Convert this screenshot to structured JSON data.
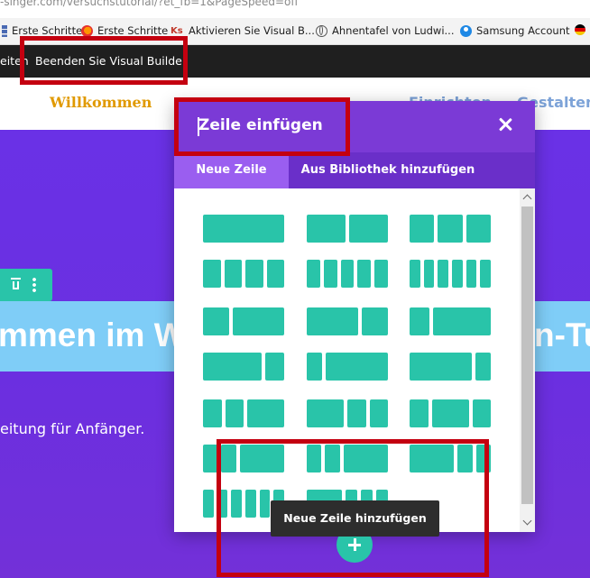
{
  "browser": {
    "url_fragment": "-singer.com/versuchstutorial/?et_fb=1&PageSpeed=off",
    "bookmarks": [
      {
        "label": "Erste Schritte",
        "icon": "bookmark-bars-icon"
      },
      {
        "label": "Erste Schritte",
        "icon": "firefox-icon"
      },
      {
        "label": "Aktivieren Sie Visual B...",
        "icon": "ks-logo-icon"
      },
      {
        "label": "Ahnentafel von Ludwi...",
        "icon": "globe-icon"
      },
      {
        "label": "Samsung Account",
        "icon": "samsung-account-icon"
      },
      {
        "label": "",
        "icon": "german-flag-icon"
      }
    ]
  },
  "builder_bar": {
    "left_partial": "eiten",
    "exit_label": "Beenden Sie Visual Builder"
  },
  "site_nav": {
    "home": "Willkommen",
    "item_b": "Einrichten",
    "item_c": "Gestalten"
  },
  "hero": {
    "heading_left": "mmen im W",
    "heading_right": "n-Tu",
    "subtitle": "eitung für Anfänger."
  },
  "modal": {
    "title": "Zeile einfügen",
    "tabs": [
      {
        "label": "Neue Zeile",
        "active": true
      },
      {
        "label": "Aus Bibliothek hinzufügen",
        "active": false
      }
    ],
    "layouts": [
      [
        1
      ],
      [
        1,
        1
      ],
      [
        1,
        1,
        1
      ],
      [
        1,
        1,
        1,
        1
      ],
      [
        1,
        1,
        1,
        1,
        1
      ],
      [
        1,
        1,
        1,
        1,
        1,
        1
      ],
      [
        1,
        2
      ],
      [
        2,
        1
      ],
      [
        1,
        3
      ],
      [
        3,
        1
      ],
      [
        1,
        4
      ],
      [
        4,
        1
      ],
      [
        1,
        1,
        2
      ],
      [
        2,
        1,
        1
      ],
      [
        1,
        2,
        1
      ],
      [
        1,
        1,
        3
      ],
      [
        1,
        1,
        3
      ],
      [
        3,
        1,
        1
      ],
      [
        1,
        1,
        1,
        1,
        1,
        1
      ],
      [
        3,
        1,
        1,
        1
      ],
      [
        0,
        0
      ]
    ],
    "tooltip": "Neue Zeile hinzufügen"
  },
  "colors": {
    "accent_teal": "#29c4a9",
    "modal_header": "#7b3ad6",
    "hero_purple": "#6a31e6",
    "annotation_red": "#c40010"
  }
}
